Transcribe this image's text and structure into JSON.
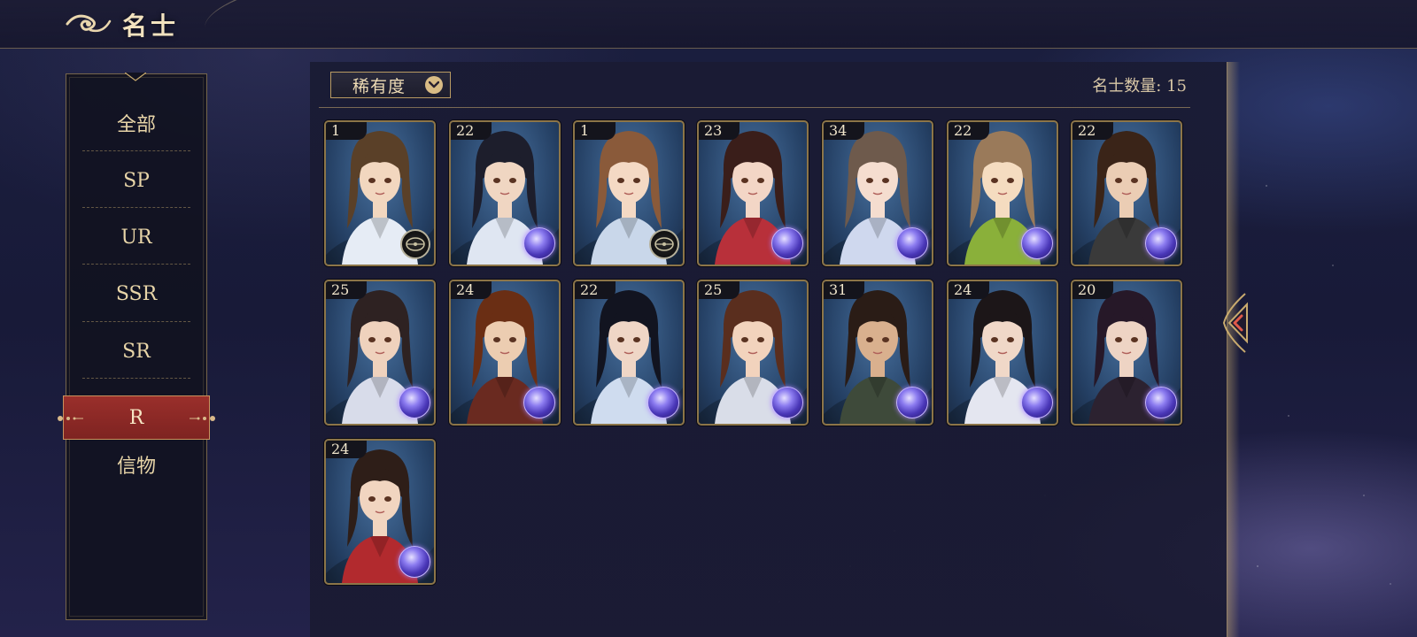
{
  "header": {
    "title": "名士",
    "back_icon": "cloud-swirl-back-icon"
  },
  "filter": {
    "dropdown_label": "稀有度",
    "dropdown_icon": "chevron-down-icon",
    "count_label": "名士数量: 15"
  },
  "categories": [
    {
      "label": "全部",
      "active": false
    },
    {
      "label": "SP",
      "active": false
    },
    {
      "label": "UR",
      "active": false
    },
    {
      "label": "SSR",
      "active": false
    },
    {
      "label": "SR",
      "active": false
    },
    {
      "label": "R",
      "active": true
    },
    {
      "label": "信物",
      "active": false
    }
  ],
  "cards": [
    {
      "level": "1",
      "badge": "compass-icon",
      "hair": "#5a4028",
      "skin": "#f2d7bf",
      "robe": "#e6ecf5"
    },
    {
      "level": "22",
      "badge": "orb-icon",
      "hair": "#1d1e2c",
      "skin": "#f0d6c2",
      "robe": "#dfe6f2"
    },
    {
      "level": "1",
      "badge": "compass-icon",
      "hair": "#8a5a3a",
      "skin": "#f4d9c4",
      "robe": "#c9d7ea"
    },
    {
      "level": "23",
      "badge": "orb-icon",
      "hair": "#3a1e1a",
      "skin": "#f3d6c6",
      "robe": "#b8303a"
    },
    {
      "level": "34",
      "badge": "orb-icon",
      "hair": "#6e5a4c",
      "skin": "#f5ddcf",
      "robe": "#cfd8ee"
    },
    {
      "level": "22",
      "badge": "orb-icon",
      "hair": "#9a7a5a",
      "skin": "#f5dcc0",
      "robe": "#8ab03a"
    },
    {
      "level": "22",
      "badge": "orb-icon",
      "hair": "#3a2418",
      "skin": "#ebcdb4",
      "robe": "#3a3a3a"
    },
    {
      "level": "25",
      "badge": "orb-icon",
      "hair": "#2e2222",
      "skin": "#efd2bd",
      "robe": "#d8dcea"
    },
    {
      "level": "24",
      "badge": "orb-icon",
      "hair": "#6a2e14",
      "skin": "#eccdb1",
      "robe": "#6a2a20"
    },
    {
      "level": "22",
      "badge": "orb-icon",
      "hair": "#121420",
      "skin": "#efd6c6",
      "robe": "#cfdcef"
    },
    {
      "level": "25",
      "badge": "orb-icon",
      "hair": "#5a2e1e",
      "skin": "#f2d3bd",
      "robe": "#d9dde8"
    },
    {
      "level": "31",
      "badge": "orb-icon",
      "hair": "#2a1c16",
      "skin": "#d9b08e",
      "robe": "#3e4a3a"
    },
    {
      "level": "24",
      "badge": "orb-icon",
      "hair": "#1c1618",
      "skin": "#f0d8c8",
      "robe": "#e4e6f0"
    },
    {
      "level": "20",
      "badge": "orb-icon",
      "hair": "#261828",
      "skin": "#eed4c4",
      "robe": "#2c2230"
    },
    {
      "level": "24",
      "badge": "orb-icon",
      "hair": "#2e1e18",
      "skin": "#f1d5c0",
      "robe": "#b22a2e"
    }
  ],
  "side": {
    "collapse_icon": "chevron-left-icon"
  },
  "colors": {
    "gold": "#c8aa6e",
    "active_red": "#8a2a27",
    "panel_dark": "#111221"
  }
}
